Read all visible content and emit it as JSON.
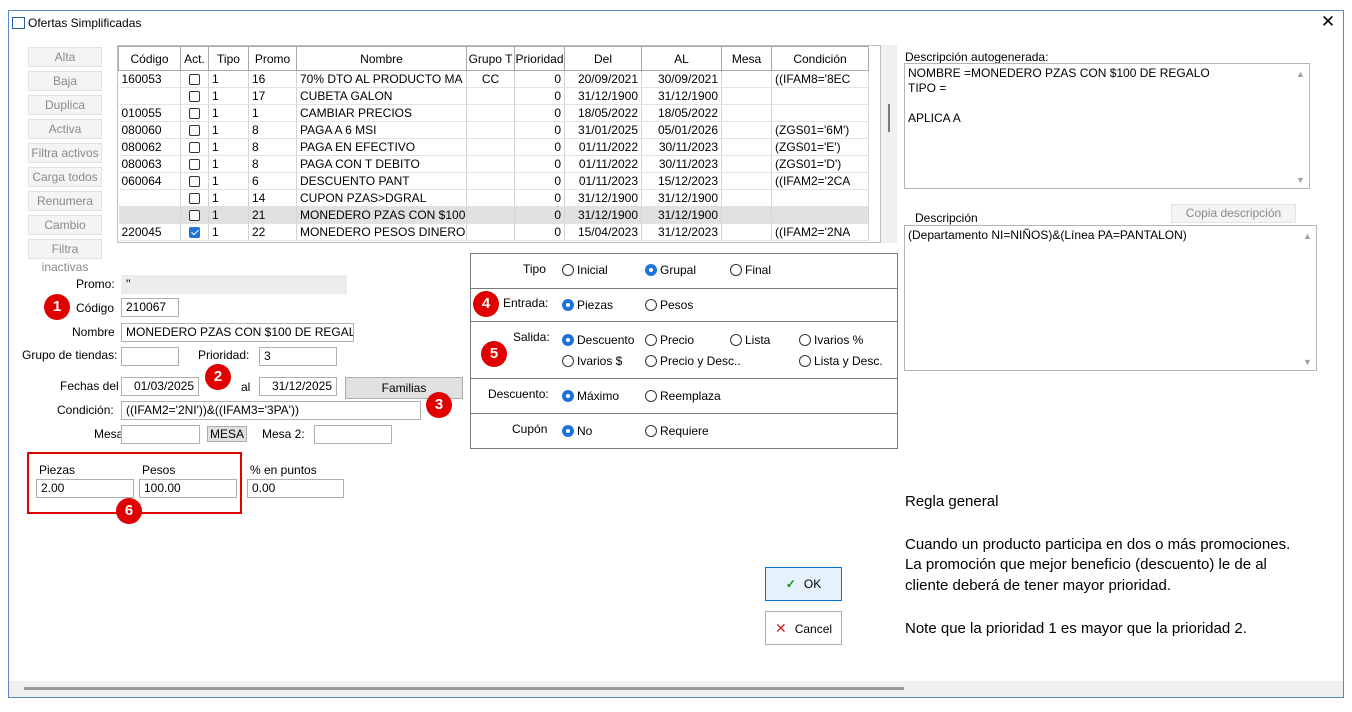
{
  "window": {
    "title": "Ofertas Simplificadas"
  },
  "sidebar": {
    "buttons": [
      "Alta",
      "Baja",
      "Duplica",
      "Activa",
      "Filtra activos",
      "Carga todos",
      "Renumera",
      "Cambio",
      "Filtra inactivas"
    ]
  },
  "grid": {
    "columns": [
      "Código",
      "Act.",
      "Tipo",
      "Promo",
      "Nombre",
      "Grupo T",
      "Prioridad",
      "Del",
      "AL",
      "Mesa",
      "Condición"
    ],
    "rows": [
      {
        "codigo": "160053",
        "act": false,
        "tipo": "1",
        "promo": "16",
        "nombre": "70% DTO AL PRODUCTO MA",
        "grupo": "CC",
        "prioridad": "0",
        "del": "20/09/2021",
        "al": "30/09/2021",
        "mesa": "",
        "condicion": "((IFAM8='8EC",
        "selected": false
      },
      {
        "codigo": "",
        "act": false,
        "tipo": "1",
        "promo": "17",
        "nombre": "CUBETA GALON",
        "grupo": "",
        "prioridad": "0",
        "del": "31/12/1900",
        "al": "31/12/1900",
        "mesa": "",
        "condicion": "",
        "selected": false
      },
      {
        "codigo": "010055",
        "act": false,
        "tipo": "1",
        "promo": "1",
        "nombre": "CAMBIAR PRECIOS",
        "grupo": "",
        "prioridad": "0",
        "del": "18/05/2022",
        "al": "18/05/2022",
        "mesa": "",
        "condicion": "",
        "selected": false
      },
      {
        "codigo": "080060",
        "act": false,
        "tipo": "1",
        "promo": "8",
        "nombre": "PAGA A 6 MSI",
        "grupo": "",
        "prioridad": "0",
        "del": "31/01/2025",
        "al": "05/01/2026",
        "mesa": "",
        "condicion": "(ZGS01='6M')",
        "selected": false
      },
      {
        "codigo": "080062",
        "act": false,
        "tipo": "1",
        "promo": "8",
        "nombre": "PAGA EN EFECTIVO",
        "grupo": "",
        "prioridad": "0",
        "del": "01/11/2022",
        "al": "30/11/2023",
        "mesa": "",
        "condicion": "(ZGS01='E')",
        "selected": false
      },
      {
        "codigo": "080063",
        "act": false,
        "tipo": "1",
        "promo": "8",
        "nombre": "PAGA CON T DEBITO",
        "grupo": "",
        "prioridad": "0",
        "del": "01/11/2022",
        "al": "30/11/2023",
        "mesa": "",
        "condicion": "(ZGS01='D')",
        "selected": false
      },
      {
        "codigo": "060064",
        "act": false,
        "tipo": "1",
        "promo": "6",
        "nombre": "DESCUENTO PANT",
        "grupo": "",
        "prioridad": "0",
        "del": "01/11/2023",
        "al": "15/12/2023",
        "mesa": "",
        "condicion": "((IFAM2='2CA",
        "selected": false
      },
      {
        "codigo": "",
        "act": false,
        "tipo": "1",
        "promo": "14",
        "nombre": "CUPON PZAS>DGRAL",
        "grupo": "",
        "prioridad": "0",
        "del": "31/12/1900",
        "al": "31/12/1900",
        "mesa": "",
        "condicion": "",
        "selected": false
      },
      {
        "codigo": "",
        "act": false,
        "tipo": "1",
        "promo": "21",
        "nombre": "MONEDERO PZAS CON $100",
        "grupo": "",
        "prioridad": "0",
        "del": "31/12/1900",
        "al": "31/12/1900",
        "mesa": "",
        "condicion": "",
        "selected": true
      },
      {
        "codigo": "220045",
        "act": true,
        "tipo": "1",
        "promo": "22",
        "nombre": "MONEDERO PESOS DINERO",
        "grupo": "",
        "prioridad": "0",
        "del": "15/04/2023",
        "al": "31/12/2023",
        "mesa": "",
        "condicion": "((IFAM2='2NA",
        "selected": false
      }
    ]
  },
  "form": {
    "promo_label": "Promo:",
    "promo_value": "''",
    "codigo_label": "Código",
    "codigo_value": "210067",
    "nombre_label": "Nombre",
    "nombre_value": "MONEDERO PZAS CON $100 DE REGALO",
    "grupo_label": "Grupo de tiendas:",
    "grupo_value": "",
    "prioridad_label": "Prioridad:",
    "prioridad_value": "3",
    "fechas_label": "Fechas del",
    "fecha_del": "01/03/2025",
    "al_label": "al",
    "fecha_al": "31/12/2025",
    "familias_button": "Familias",
    "condicion_label": "Condición:",
    "condicion_value": "((IFAM2='2NI'))&((IFAM3='3PA'))",
    "mesa_label": "Mesa:",
    "mesa_value": "",
    "mesa_button": "MESA",
    "mesa2_label": "Mesa 2:",
    "mesa2_value": "",
    "piezas_label": "Piezas",
    "piezas_value": "2.00",
    "pesos_label": "Pesos",
    "pesos_value": "100.00",
    "puntos_label": "% en puntos",
    "puntos_value": "0.00"
  },
  "badges": [
    "1",
    "2",
    "3",
    "4",
    "5",
    "6"
  ],
  "options": {
    "tipo": {
      "label": "Tipo",
      "items": [
        {
          "label": "Inicial",
          "on": false
        },
        {
          "label": "Grupal",
          "on": true
        },
        {
          "label": "Final",
          "on": false
        }
      ]
    },
    "entrada": {
      "label": "Entrada:",
      "items": [
        {
          "label": "Piezas",
          "on": true
        },
        {
          "label": "Pesos",
          "on": false
        }
      ]
    },
    "salida": {
      "label": "Salida:",
      "items": [
        {
          "label": "Descuento",
          "on": true
        },
        {
          "label": "Precio",
          "on": false
        },
        {
          "label": "Lista",
          "on": false
        },
        {
          "label": "Ivarios %",
          "on": false
        },
        {
          "label": "Ivarios $",
          "on": false
        },
        {
          "label": "Precio y Desc..",
          "on": false
        },
        {
          "label": "Lista y Desc.",
          "on": false
        }
      ]
    },
    "descuento": {
      "label": "Descuento:",
      "items": [
        {
          "label": "Máximo",
          "on": true
        },
        {
          "label": "Reemplaza",
          "on": false
        }
      ]
    },
    "cupon": {
      "label": "Cupón",
      "items": [
        {
          "label": "No",
          "on": true
        },
        {
          "label": "Requiere",
          "on": false
        }
      ]
    }
  },
  "right": {
    "auto_label": "Descripción autogenerada:",
    "auto_text": "NOMBRE =MONEDERO PZAS CON $100 DE REGALO\nTIPO =\n\nAPLICA A",
    "desc_label": "Descripción",
    "copia_button": "Copia descripción",
    "desc_text": "(Departamento NI=NIÑOS)&(Línea PA=PANTALON)"
  },
  "buttons": {
    "ok": "OK",
    "cancel": "Cancel"
  },
  "note": {
    "title": "Regla general",
    "lines": [
      "Cuando un producto participa en dos o más  promociones.",
      "La promoción que mejor beneficio (descuento)  le de al",
      "cliente deberá de tener mayor prioridad."
    ],
    "footer": "Note que la prioridad 1 es mayor que la prioridad 2."
  },
  "colors": {
    "accent": "#1e73d8",
    "marker": "#e00000",
    "window_border": "#5a8ac6"
  }
}
